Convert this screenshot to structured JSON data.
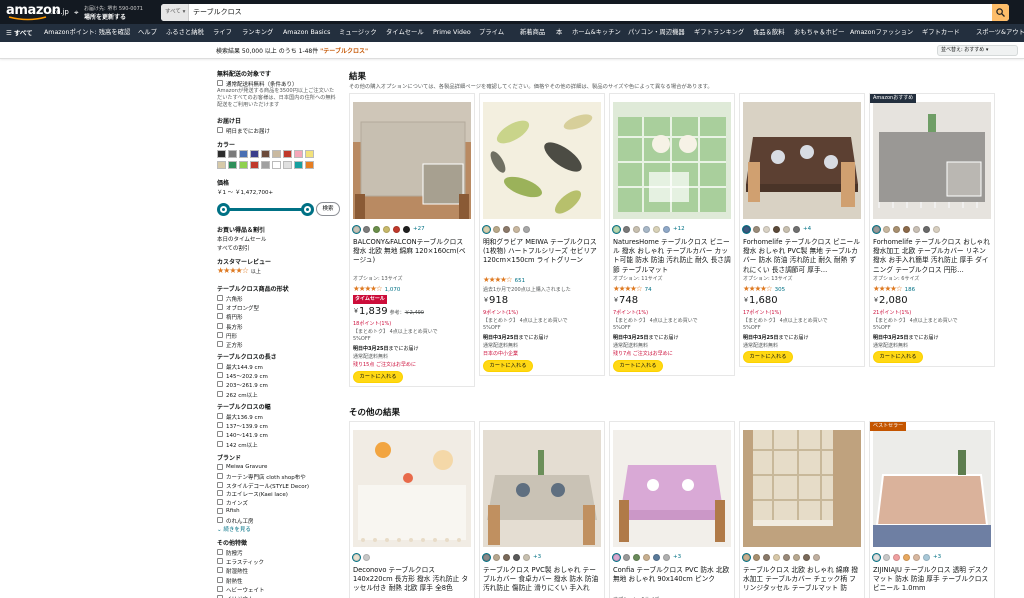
{
  "header": {
    "logo_text": "amazon",
    "logo_tld": ".co.jp",
    "deliver_line1": "お届け先: 堺市 590-0071",
    "deliver_line2": "場所を更新する",
    "search_category": "すべて",
    "search_query": "テーブルクロス"
  },
  "nav": {
    "all": "すべて",
    "items": [
      "Amazonポイント: 残高を確認",
      "ヘルプ",
      "ふるさと納税",
      "ライフ",
      "ランキング",
      "Amazon Basics",
      "ミュージック",
      "タイムセール",
      "Prime Video",
      "プライム",
      "新着商品",
      "本",
      "ホーム&キッチン",
      "パソコン・周辺機器",
      "ギフトランキング",
      "食品＆飲料",
      "おもちゃ＆ホビー",
      "Amazonファッション",
      "ギフトカード",
      "スポーツ&アウトドア"
    ]
  },
  "results_bar": {
    "text": "検索結果 50,000 以上 のうち 1-48件",
    "keyword": "\"テーブルクロス\"",
    "sort": "並べ替え: おすすめ"
  },
  "sidebar": {
    "free_shipping_h": "無料配送の対象です",
    "free_shipping_cb": "通常配送料無料（条件あり）",
    "free_shipping_note": "Amazonが発送する商品を3500円以上ご注文いただいたすべてのお客様は、日本国内の住所への無料配送をご利用いただけます",
    "delivery_h": "お届け日",
    "delivery_cb": "明日までにお届け",
    "color_h": "カラー",
    "colors": [
      "#2b2b2b",
      "#7a7a7a",
      "#4a6fb3",
      "#3b3f8c",
      "#6b4a3a",
      "#c9b9a0",
      "#c0392b",
      "#f4a7b9",
      "#f3e27a",
      "#d6c9a8",
      "#2f8f5a",
      "#8fd14f",
      "#c0392b",
      "#a0a0a0",
      "#ffffff",
      "#e0e0e0",
      "#16a0a0",
      "#e67e22"
    ],
    "price_h": "価格",
    "price_range": "￥1 ～ ￥1,472,700+",
    "price_go": "検索",
    "deals_h": "お買い得品＆割引",
    "deals_1": "本日のタイムセール",
    "deals_2": "すべての割引",
    "review_h": "カスタマーレビュー",
    "review_stars": "★★★★☆",
    "review_up": "以上",
    "shape_h": "テーブルクロス商品の形状",
    "shapes": [
      "六角形",
      "オブロング型",
      "楕円形",
      "長方形",
      "円形",
      "正方形"
    ],
    "length_h": "テーブルクロスの長さ",
    "lengths": [
      "最大144.9 cm",
      "145～202.9 cm",
      "203～261.9 cm",
      "262 cm以上"
    ],
    "width_h": "テーブルクロスの幅",
    "widths": [
      "最大136.9 cm",
      "137～139.9 cm",
      "140～141.9 cm",
      "142 cm以上"
    ],
    "brand_h": "ブランド",
    "brands": [
      "Meiwa Gravure",
      "カーテン専門店 cloth shop布や",
      "スタイルデコール(STYLE Decor)",
      "カエイレース(Kaei lace)",
      "カインズ",
      "Rfish",
      "のれん工房"
    ],
    "brands_more": "続きを見る",
    "features_h": "その他特徴",
    "features": [
      "防撥汚",
      "エラスティック",
      "耐湿熱性",
      "耐熱性",
      "ヘビーウェイト",
      "イリジウム"
    ]
  },
  "main": {
    "results_title": "結果",
    "results_sub": "その他の購入オプションについては、各製品詳細ページを確認してください。価格やその他の詳細は、製品のサイズや色によって異なる場合があります。",
    "other_title": "その他の結果",
    "cards": [
      {
        "badge": "",
        "dot_colors": [
          "#c8c3b8",
          "#7d7d7d",
          "#6b8f4a",
          "#c8b96a",
          "#c0392b",
          "#1f1f1f"
        ],
        "more": "+27",
        "title": "BALCONY&FALCONテーブルクロス 撥水 北欧 無地 綿麻 120×160cm(ベージュ)",
        "option": "オプション: 13サイズ",
        "stars": "★★★★☆",
        "reviews": "1,070",
        "bought": "",
        "timesale": "タイムセール",
        "yen": "￥",
        "price": "1,839",
        "ref_label": "参考：",
        "ref_price": "￥2,490",
        "points": "18ポイント(1%)",
        "coupon": "【まとめトク】 4点以上まとめ買いで",
        "coupon2": "5%OFF",
        "delivery": "明日中3月25日",
        "delivery_tail": "までにお届け",
        "shipping": "通常配送料無料",
        "stock": "残り15点 ご注文はお早めに",
        "cart": "カートに入れる"
      },
      {
        "badge": "",
        "dot_colors": [
          "#d7cfae",
          "#b9a98a",
          "#8c7a6a",
          "#c9b8a0",
          "#a8a8a8"
        ],
        "more": "",
        "title": "明和グラビア MEIWA テーブルクロス(1枚物) ハートフルシリーズ セビリア 120cm×150cm ライトグリーン",
        "option": "",
        "stars": "★★★★☆",
        "reviews": "651",
        "bought": "過去1か月で200点以上購入されました",
        "timesale": "",
        "yen": "￥",
        "price": "918",
        "ref_label": "",
        "ref_price": "",
        "points": "9ポイント(1%)",
        "coupon": "【まとめトク】 4点以上まとめ買いで",
        "coupon2": "5%OFF",
        "delivery": "明日中3月25日",
        "delivery_tail": "までにお届け",
        "shipping": "通常配送料無料",
        "stock": "日本の中小企業",
        "cart": "カートに入れる"
      },
      {
        "badge": "",
        "dot_colors": [
          "#b8d8b0",
          "#7a7a7a",
          "#c8c0b0",
          "#a8b8c8",
          "#d9d2b8",
          "#8fa8c8"
        ],
        "more": "+12",
        "title": "NaturesHome テーブルクロス ビニール 撥水 おしゃれ テーブルカバー カット可能 防水 防油 汚れ防止 耐久 長さ調節 テーブルマット",
        "option": "オプション: 11サイズ",
        "stars": "★★★★☆",
        "reviews": "74",
        "bought": "",
        "timesale": "",
        "yen": "￥",
        "price": "748",
        "ref_label": "",
        "ref_price": "",
        "points": "7ポイント(1%)",
        "coupon": "【まとめトク】 4点以上まとめ買いで",
        "coupon2": "5%OFF",
        "delivery": "明日中3月25日",
        "delivery_tail": "までにお届け",
        "shipping": "通常配送料無料",
        "stock": "残り7点 ご注文はお早めに",
        "cart": "カートに入れる"
      },
      {
        "badge": "",
        "dot_colors": [
          "#3d5a80",
          "#9a8c7a",
          "#d9d2c5",
          "#5c4a3a",
          "#c8c0b0",
          "#707070"
        ],
        "more": "+4",
        "title": "Forhomelife テーブルクロス ビニール 撥水 おしゃれ PVC製 無地 テーブルカバー 防水 防油 汚れ防止 耐久 耐熱 ずれにくい 長さ調節可 厚手…",
        "option": "オプション: 13サイズ",
        "stars": "★★★★☆",
        "reviews": "305",
        "bought": "",
        "timesale": "",
        "yen": "￥",
        "price": "1,680",
        "ref_label": "",
        "ref_price": "",
        "points": "17ポイント(1%)",
        "coupon": "【まとめトク】 4点以上まとめ買いで",
        "coupon2": "5%OFF",
        "delivery": "明日中3月25日",
        "delivery_tail": "までにお届け",
        "shipping": "通常配送料無料",
        "stock": "",
        "cart": "カートに入れる"
      },
      {
        "badge": "Amazonおすすめ",
        "dot_colors": [
          "#9a9a9a",
          "#c8b8a0",
          "#a89070",
          "#8c6a4a",
          "#c9c0b5",
          "#6a6a6a",
          "#d8cfc0"
        ],
        "more": "",
        "title": "Forhomelife テーブルクロス おしゃれ 撥水加工 北欧 テーブルカバー リネン 撥水 お手入れ簡単 汚れ防止 厚手 ダイニング テーブルクロス 円形…",
        "option": "オプション: 6サイズ",
        "stars": "★★★★☆",
        "reviews": "186",
        "bought": "",
        "timesale": "",
        "yen": "￥",
        "price": "2,080",
        "ref_label": "",
        "ref_price": "",
        "points": "21ポイント(1%)",
        "coupon": "【まとめトク】 4点以上まとめ買いで",
        "coupon2": "5%OFF",
        "delivery": "明日中3月25日",
        "delivery_tail": "までにお届け",
        "shipping": "通常配送料無料",
        "stock": "",
        "cart": "カートに入れる"
      }
    ],
    "cards2": [
      {
        "badge": "",
        "dot_colors": [
          "#e8e0d0",
          "#c8c8c8"
        ],
        "more": "",
        "title": "Deconovo テーブルクロス 140x220cm 長方形 撥水 汚れ防止 タッセル付き 耐熱 北欧 厚手 全8色"
      },
      {
        "badge": "",
        "dot_colors": [
          "#8a8a8a",
          "#b8a890",
          "#7a6a5a",
          "#5a5a5a",
          "#c8c0b0"
        ],
        "more": "+3",
        "title": "テーブルクロス PVC製 おしゃれ テーブルカバー 食卓カバー 撥水 防水 防油 汚れ防止 傷防止 滑りにくい 手入れ"
      },
      {
        "badge": "",
        "dot_colors": [
          "#d8a8d0",
          "#9a9a9a",
          "#6a8a5a",
          "#c8b090",
          "#5a7a9a",
          "#b0b0b0"
        ],
        "more": "+3",
        "title": "Confia テーブルクロス PVC 防水 北欧 無地 おしゃれ 90x140cm ピンク",
        "option": "オプション: 6サイズ"
      },
      {
        "badge": "",
        "dot_colors": [
          "#c8b090",
          "#a89070",
          "#8a7a6a",
          "#d8c8a8",
          "#9a8a7a",
          "#b8a890",
          "#7a6a5a",
          "#c0b0a0"
        ],
        "more": "",
        "title": "テーブルクロス 北欧 おしゃれ 綿麻 撥水加工 テーブルカバー チェック柄 フリンジタッセル テーブルマット 防"
      },
      {
        "badge": "ベストセラー",
        "dot_colors": [
          "#e0e0e0",
          "#c8c8c8",
          "#f0a0a0",
          "#e8a860",
          "#d8b8a0",
          "#a8c8d8"
        ],
        "more": "+3",
        "title": "ZIJINIAJU テーブルクロス 透明 デスクマット 防水 防油 厚手 テーブルクロスビニール 1.0mm"
      }
    ]
  }
}
